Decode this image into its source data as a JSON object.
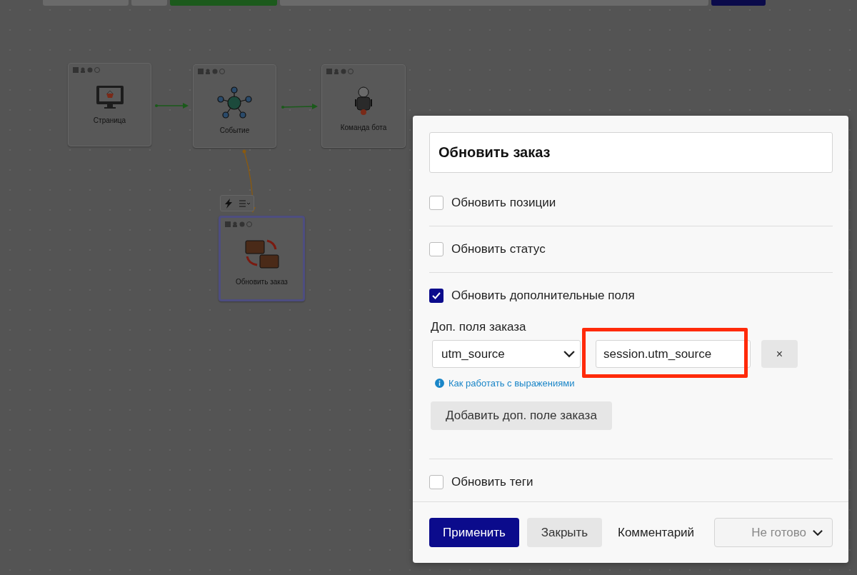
{
  "nodes": [
    {
      "label": "Страница",
      "kind": "page",
      "selected": false
    },
    {
      "label": "Событие",
      "kind": "event",
      "selected": false
    },
    {
      "label": "Команда бота",
      "kind": "bot",
      "selected": false
    },
    {
      "label": "Обновить заказ",
      "kind": "order",
      "selected": true
    }
  ],
  "dialog": {
    "title": "Обновить заказ",
    "options": [
      {
        "label": "Обновить позиции",
        "checked": false
      },
      {
        "label": "Обновить статус",
        "checked": false
      },
      {
        "label": "Обновить дополнительные поля",
        "checked": true,
        "fields_label": "Доп. поля заказа",
        "field": {
          "name": "utm_source",
          "value": "session.utm_source",
          "remove": "×",
          "highlighted": true
        },
        "help_link": "Как работать с выражениями",
        "add_button": "Добавить доп. поле заказа"
      },
      {
        "label": "Обновить теги",
        "checked": false
      }
    ],
    "footer": {
      "apply": "Применить",
      "close": "Закрыть",
      "comment": "Комментарий",
      "status": "Не готово"
    }
  }
}
